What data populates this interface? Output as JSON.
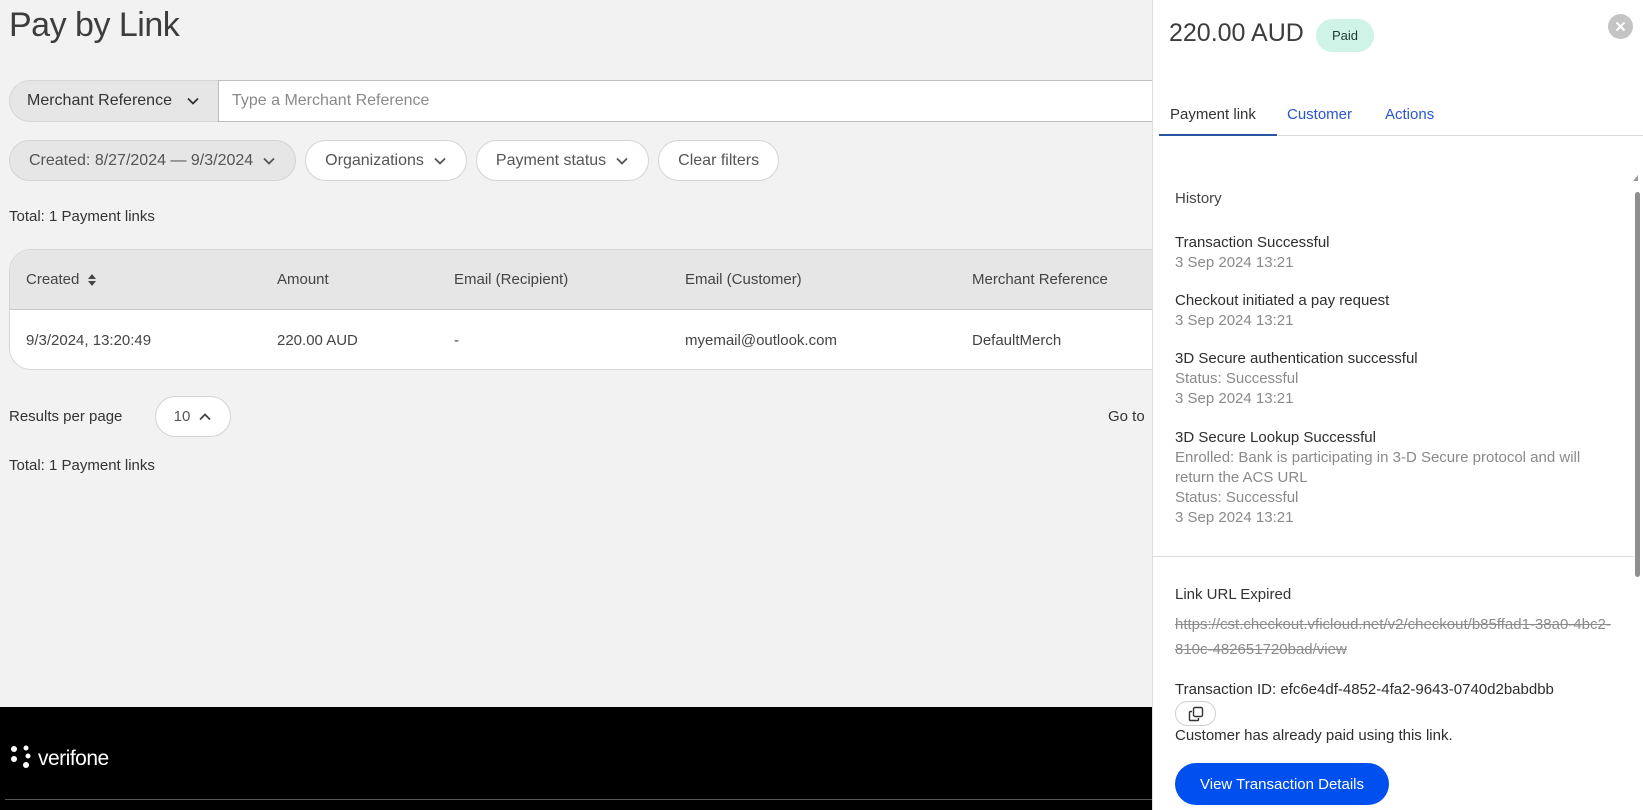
{
  "page": {
    "title": "Pay by Link"
  },
  "search": {
    "type_label": "Merchant Reference",
    "placeholder": "Type a Merchant Reference",
    "value": ""
  },
  "filters": [
    {
      "label": "Created: 8/27/2024 — 9/3/2024",
      "active": true
    },
    {
      "label": "Organizations",
      "active": false
    },
    {
      "label": "Payment status",
      "active": false
    },
    {
      "label": "Clear filters",
      "active": false
    }
  ],
  "total_top": "Total: 1 Payment links",
  "table": {
    "columns": [
      "Created",
      "Amount",
      "Email (Recipient)",
      "Email (Customer)",
      "Merchant Reference"
    ],
    "rows": [
      [
        "9/3/2024, 13:20:49",
        "220.00 AUD",
        "-",
        "myemail@outlook.com",
        "DefaultMerch"
      ]
    ]
  },
  "pagination": {
    "results_per_page_label": "Results per page",
    "results_per_page_value": "10",
    "goto_label": "Go to"
  },
  "total_bottom": "Total: 1 Payment links",
  "footer": {
    "brand": "verifone"
  },
  "panel": {
    "amount": "220.00 AUD",
    "status_badge": "Paid",
    "tabs": [
      {
        "label": "Payment link",
        "active": true
      },
      {
        "label": "Customer",
        "active": false
      },
      {
        "label": "Actions",
        "active": false
      }
    ],
    "history_title": "History",
    "history": [
      {
        "title": "Transaction Successful",
        "lines": [
          "3 Sep 2024 13:21"
        ]
      },
      {
        "title": "Checkout initiated a pay request",
        "lines": [
          "3 Sep 2024 13:21"
        ]
      },
      {
        "title": "3D Secure authentication successful",
        "lines": [
          "Status: Successful",
          "3 Sep 2024 13:21"
        ]
      },
      {
        "title": "3D Secure Lookup Successful",
        "lines": [
          "Enrolled: Bank is participating in 3-D Secure protocol and will return the ACS URL",
          "Status: Successful",
          "3 Sep 2024 13:21"
        ]
      }
    ],
    "link_title": "Link URL Expired",
    "link_url": "https://cst.checkout.vficloud.net/v2/checkout/b85ffad1-38a0-4bc2-810c-482651720bad/view",
    "transaction_id": "Transaction ID: efc6e4df-4852-4fa2-9643-0740d2babdbb",
    "paid_message": "Customer has already paid using this link.",
    "primary_button": "View Transaction Details"
  },
  "colors": {
    "accent_blue": "#0050ef",
    "tab_link": "#2a55d6",
    "paid_badge_bg": "#cff3e6",
    "page_bg": "#f2f2f2"
  }
}
